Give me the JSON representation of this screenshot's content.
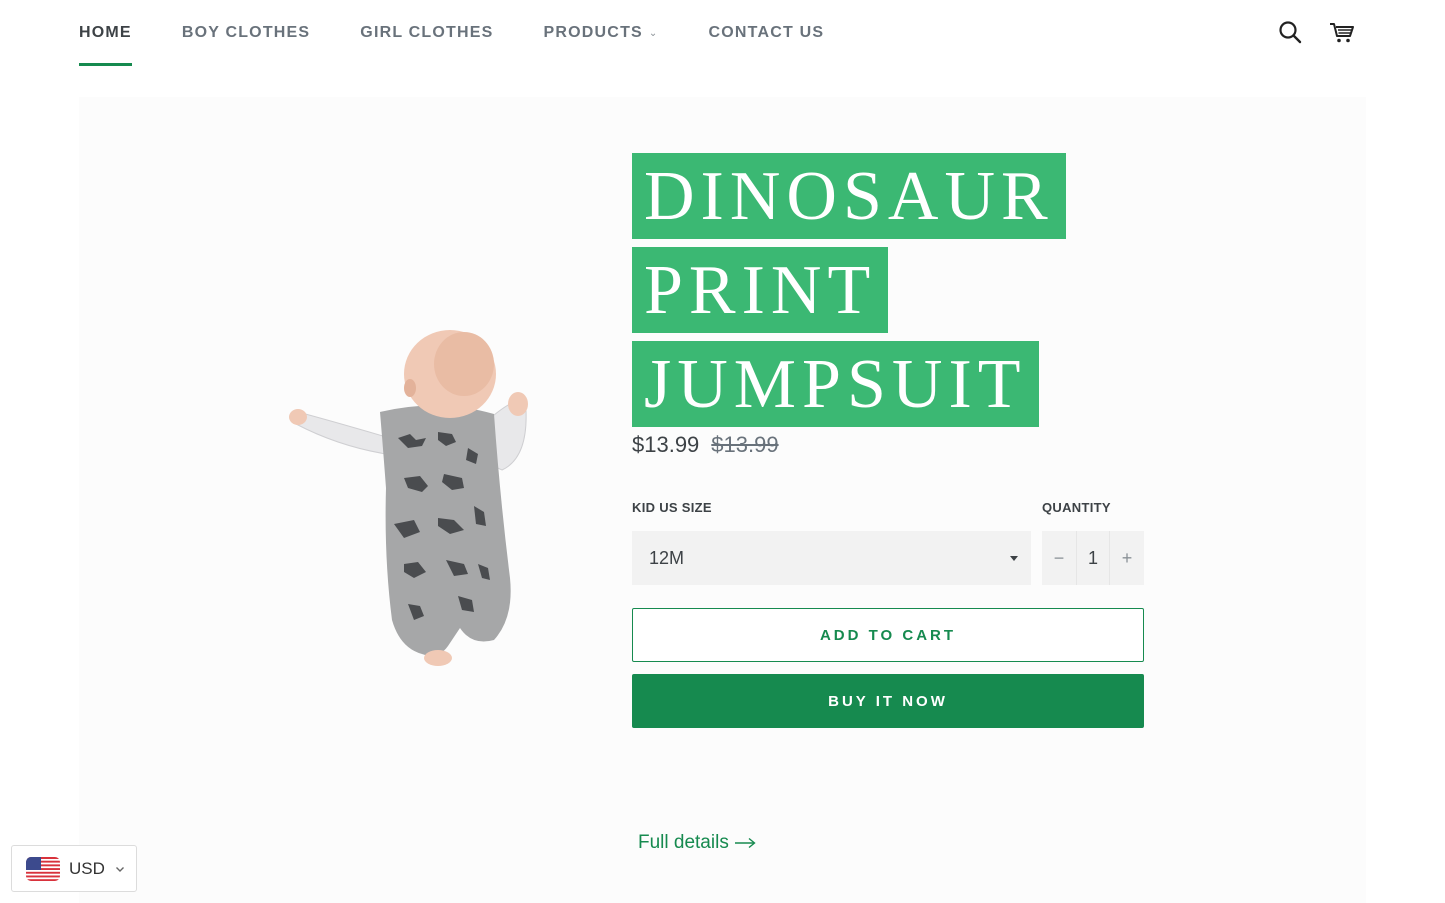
{
  "nav": {
    "items": [
      {
        "label": "HOME",
        "active": true
      },
      {
        "label": "BOY CLOTHES",
        "active": false
      },
      {
        "label": "GIRL CLOTHES",
        "active": false
      },
      {
        "label": "PRODUCTS",
        "active": false,
        "has_dropdown": true
      },
      {
        "label": "CONTACT US",
        "active": false
      }
    ],
    "icons": [
      "search-icon",
      "cart-icon"
    ]
  },
  "product": {
    "title_lines": [
      "DINOSAUR",
      "PRINT",
      "JUMPSUIT"
    ],
    "price": "$13.99",
    "compare_price": "$13.99",
    "size_label": "KID US SIZE",
    "size_value": "12M",
    "quantity_label": "QUANTITY",
    "quantity_value": "1",
    "qty_minus": "−",
    "qty_plus": "+",
    "add_to_cart": "ADD TO CART",
    "buy_now": "BUY IT NOW",
    "full_details": "Full details"
  },
  "currency": {
    "code": "USD"
  },
  "colors": {
    "accent": "#168a4f",
    "title_highlight": "#3bb873"
  }
}
